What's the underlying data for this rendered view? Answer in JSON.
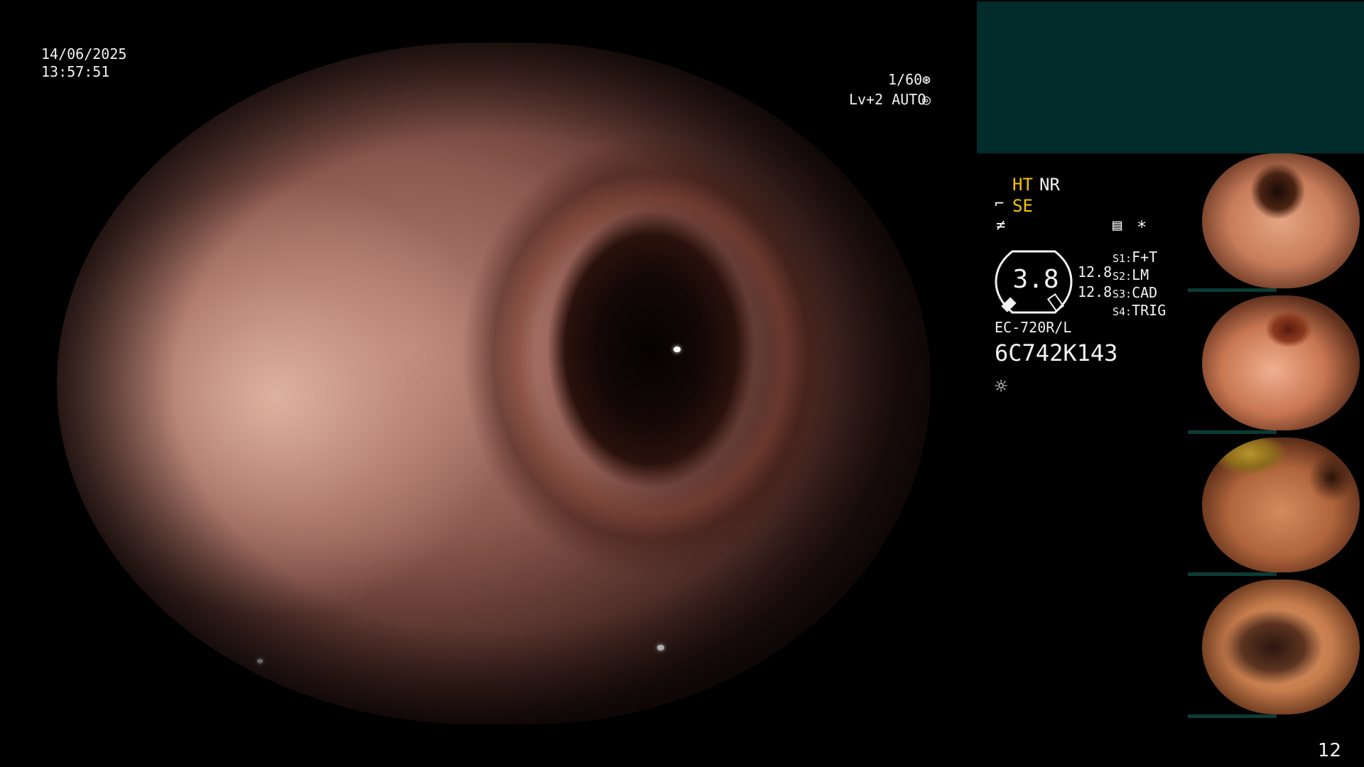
{
  "overlay": {
    "date": "14/06/2025",
    "time": "13:57:51",
    "shutter": "1/60",
    "shutter_icon": "⊛",
    "level": "Lv+2 AUTO",
    "level_icon": "◎"
  },
  "panel": {
    "mode_ht": "HT",
    "mode_nr": "NR",
    "se_icon": "⌐",
    "se": "SE",
    "freeze_icon": "≠",
    "menu_icon": "▤",
    "star": "*",
    "zoom_value": "3.8",
    "side_value_1": "12.8",
    "side_value_2": "12.8",
    "switches": [
      {
        "key": "S1:",
        "value": "F+T"
      },
      {
        "key": "S2:",
        "value": "LM"
      },
      {
        "key": "S3:",
        "value": "CAD"
      },
      {
        "key": "S4:",
        "value": "TRIG"
      }
    ],
    "scope_model": "EC-720R/L",
    "scope_serial": "6C742K143",
    "light_icon": "☼"
  },
  "thumbnails_count": 4,
  "page_number": "12",
  "colors": {
    "accent_yellow": "#f5c400",
    "panel_teal": "#022b2b"
  }
}
